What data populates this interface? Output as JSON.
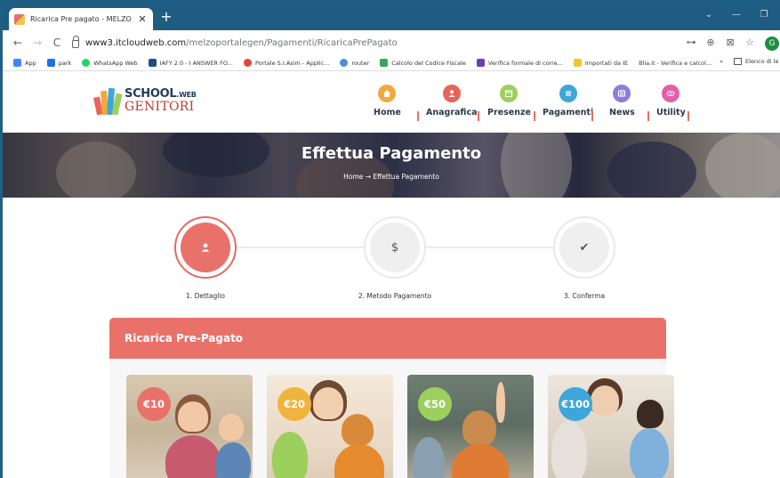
{
  "browser": {
    "tab_title": "Ricarica Pre pagato - MELZO",
    "tab_close": "✕",
    "new_tab": "+",
    "window_controls": [
      "⌄",
      "—",
      "❐"
    ],
    "nav": {
      "back": "←",
      "forward": "→",
      "reload": "C"
    },
    "url_host": "www3.itcloudweb.com",
    "url_path": "/melzoportalegen/Pagamenti/RicaricaPrePagato",
    "toolbar_icons": [
      "⊶",
      "⊕",
      "⊠",
      "☆"
    ],
    "profile_initial": "G"
  },
  "bookmarks": {
    "items": [
      {
        "label": "App",
        "color": "#4285f4"
      },
      {
        "label": "park",
        "color": "#1a73e8"
      },
      {
        "label": "WhatsApp Web",
        "color": "#25d366"
      },
      {
        "label": "IAFY 2.0 - I ANSWER FO...",
        "color": "#1a4f8a"
      },
      {
        "label": "Portale S.I.Asim - Applic...",
        "color": "#ea4335"
      },
      {
        "label": "router",
        "color": "#4a90d9"
      },
      {
        "label": "Calcolo del Codice Fiscale",
        "color": "#34a853"
      },
      {
        "label": "Verifica formale di corre...",
        "color": "#6a3fb5"
      },
      {
        "label": "Importati da IE",
        "color": "#f4c430"
      },
      {
        "label": "Blia.it - Verifica e calcol...",
        "color": "#ffffff"
      }
    ],
    "more": "»",
    "reading_list": "Elenco di le"
  },
  "site": {
    "logo_line1": "SCHOOL",
    "logo_web": ".WEB",
    "logo_line2": "GENITORI",
    "menu": [
      {
        "label": "Home",
        "color": "#f2a93b",
        "icon": "home-icon"
      },
      {
        "label": "Anagrafica",
        "color": "#e8635a",
        "icon": "user-icon"
      },
      {
        "label": "Presenze",
        "color": "#9ccf5c",
        "icon": "calendar-icon"
      },
      {
        "label": "Pagamenti",
        "color": "#3ea7d9",
        "icon": "list-icon"
      },
      {
        "label": "News",
        "color": "#8e7cdb",
        "icon": "news-icon"
      },
      {
        "label": "Utility",
        "color": "#e55fa8",
        "icon": "eye-icon"
      }
    ]
  },
  "banner": {
    "title": "Effettua Pagamento",
    "crumb_home": "Home",
    "crumb_sep": " → ",
    "crumb_current": "Effettua Pagamento"
  },
  "steps": [
    {
      "label": "1. Dettaglio",
      "glyph": "▲",
      "active": true
    },
    {
      "label": "2. Metodo Pagamento",
      "glyph": "$",
      "active": false
    },
    {
      "label": "3. Conferma",
      "glyph": "✔",
      "active": false
    }
  ],
  "panel": {
    "title": "Ricarica Pre-Pagato",
    "cards": [
      {
        "amount": "€10",
        "badge_color": "#e8726a"
      },
      {
        "amount": "€20",
        "badge_color": "#f0b43c"
      },
      {
        "amount": "€50",
        "badge_color": "#9ccf5c"
      },
      {
        "amount": "€100",
        "badge_color": "#3ea7d9"
      }
    ]
  }
}
